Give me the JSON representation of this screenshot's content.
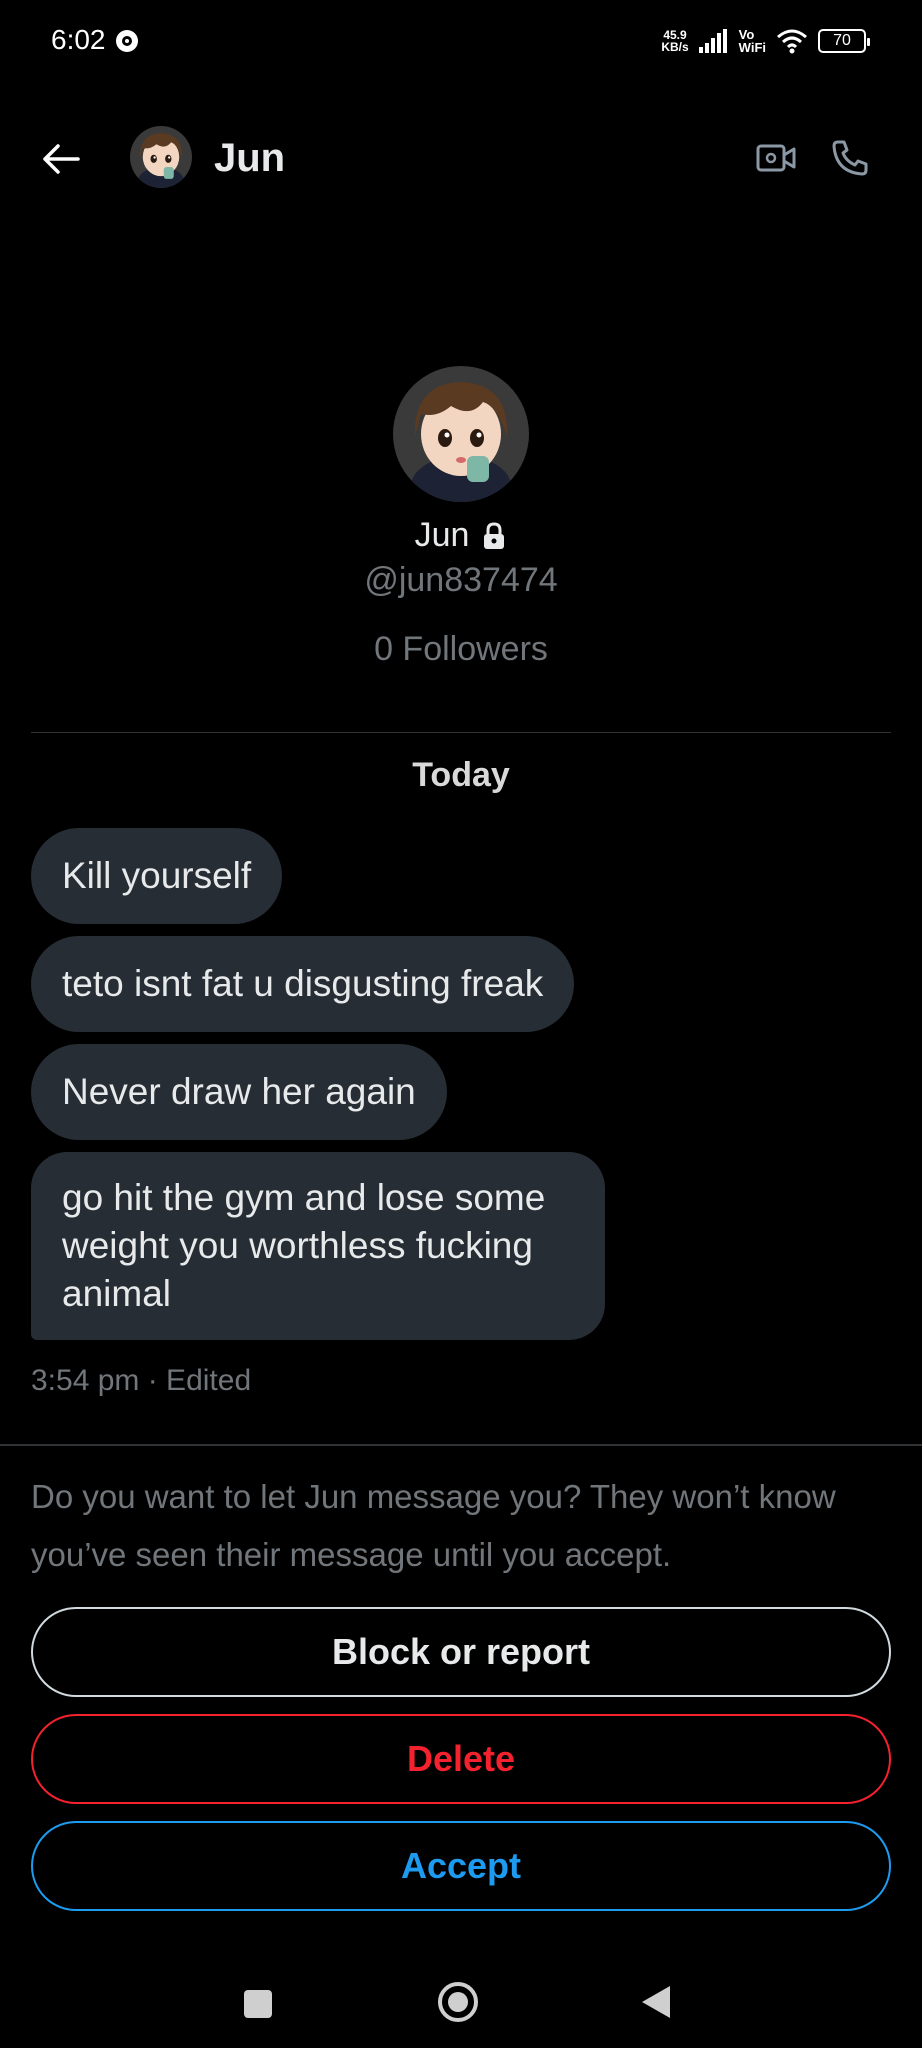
{
  "status_bar": {
    "time": "6:02",
    "net_speed_value": "45.9",
    "net_speed_unit": "KB/s",
    "volte_top": "Vo",
    "volte_bottom": "WiFi",
    "battery": "70"
  },
  "header": {
    "name": "Jun",
    "icons": [
      "back-arrow-icon",
      "video-call-icon",
      "phone-icon"
    ]
  },
  "profile": {
    "name": "Jun",
    "handle": "@jun837474",
    "followers": "0 Followers",
    "protected_icon": "lock-icon"
  },
  "conversation": {
    "date_label": "Today",
    "messages": [
      "Kill yourself",
      "teto isnt fat u disgusting freak",
      "Never draw her again",
      "go hit the gym and lose some weight you worthless fucking animal"
    ],
    "meta": "3:54 pm · Edited"
  },
  "request": {
    "prompt": "Do you want to let Jun message you? They won’t know you’ve seen their message until you accept.",
    "block_label": "Block or report",
    "delete_label": "Delete",
    "accept_label": "Accept"
  },
  "colors": {
    "background": "#000000",
    "bubble": "#262d34",
    "muted_text": "#71767b",
    "delete": "#f4212e",
    "accept": "#1d9bf0"
  },
  "navbar": {
    "icons": [
      "recents-icon",
      "home-icon",
      "back-triangle-icon"
    ]
  }
}
